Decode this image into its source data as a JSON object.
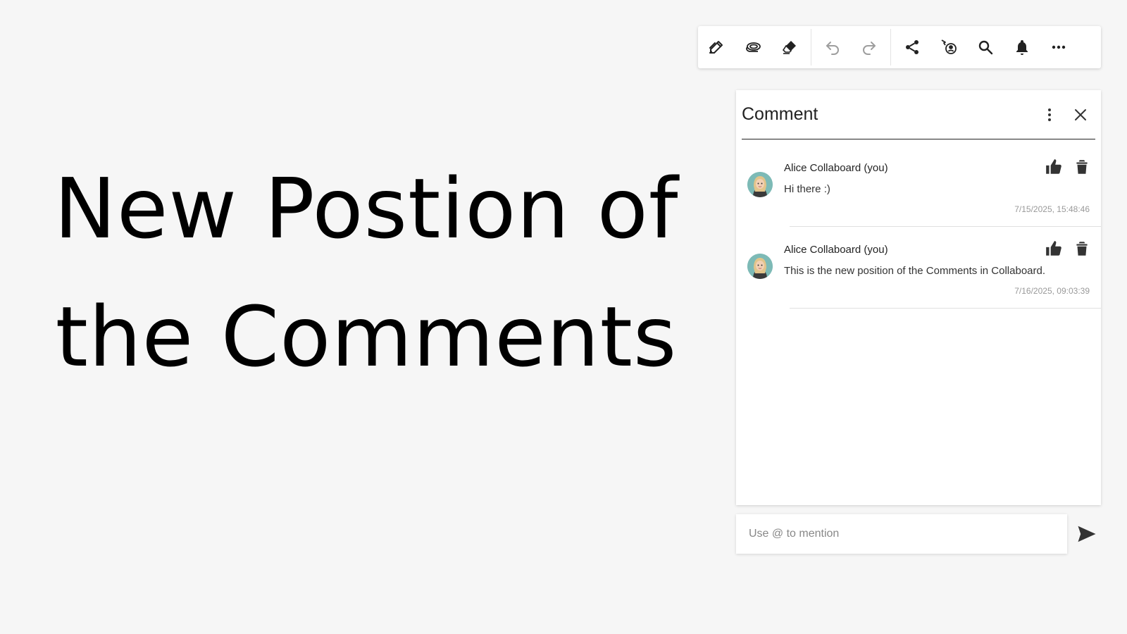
{
  "canvas": {
    "heading_line1": "New Postion of",
    "heading_line2": "the Comments"
  },
  "toolbar": {
    "tools": [
      {
        "icon": "pen-edit-icon"
      },
      {
        "icon": "lasso-icon"
      },
      {
        "icon": "eraser-icon"
      }
    ],
    "history": [
      {
        "icon": "undo-icon"
      },
      {
        "icon": "redo-icon"
      }
    ],
    "actions": [
      {
        "icon": "share-icon"
      },
      {
        "icon": "follow-presenter-icon"
      },
      {
        "icon": "search-icon"
      },
      {
        "icon": "bell-icon"
      },
      {
        "icon": "more-horizontal-icon"
      }
    ]
  },
  "comment_panel": {
    "title": "Comment",
    "comments": [
      {
        "author": "Alice Collaboard (you)",
        "text": "Hi there :)",
        "timestamp": "7/15/2025, 15:48:46"
      },
      {
        "author": "Alice Collaboard (you)",
        "text": "This is the new position of the Comments in Collaboard.",
        "timestamp": "7/16/2025, 09:03:39"
      }
    ]
  },
  "input": {
    "placeholder": "Use @ to mention",
    "value": ""
  },
  "colors": {
    "background": "#f6f6f6",
    "icon": "#222222",
    "disabled_icon": "#9e9e9e"
  }
}
